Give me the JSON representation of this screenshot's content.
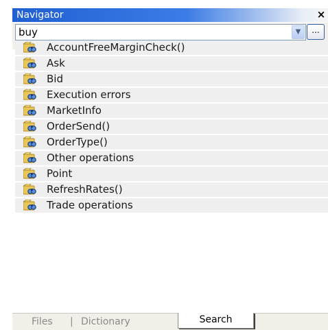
{
  "window": {
    "title": "Navigator",
    "close_glyph": "×"
  },
  "search": {
    "value": "buy",
    "dropdown_glyph": "▼",
    "browse_label": "..."
  },
  "results": [
    {
      "label": "AccountFreeMarginCheck()",
      "icon": "find-icon"
    },
    {
      "label": "Ask",
      "icon": "find-icon"
    },
    {
      "label": "Bid",
      "icon": "find-icon"
    },
    {
      "label": "Execution errors",
      "icon": "find-icon"
    },
    {
      "label": "MarketInfo",
      "icon": "find-icon"
    },
    {
      "label": "OrderSend()",
      "icon": "find-icon"
    },
    {
      "label": "OrderType()",
      "icon": "find-icon"
    },
    {
      "label": "Other operations",
      "icon": "find-icon"
    },
    {
      "label": "Point",
      "icon": "find-icon"
    },
    {
      "label": "RefreshRates()",
      "icon": "find-icon"
    },
    {
      "label": "Trade operations",
      "icon": "find-icon"
    }
  ],
  "tabs": [
    {
      "label": "Files",
      "active": false
    },
    {
      "label": "Dictionary",
      "active": false
    },
    {
      "label": "Search",
      "active": true
    }
  ],
  "tab_separator": "|",
  "colors": {
    "titlebar_start": "#1f5fd2",
    "row_background": "#efefef",
    "panel_background": "#f1efe7"
  }
}
